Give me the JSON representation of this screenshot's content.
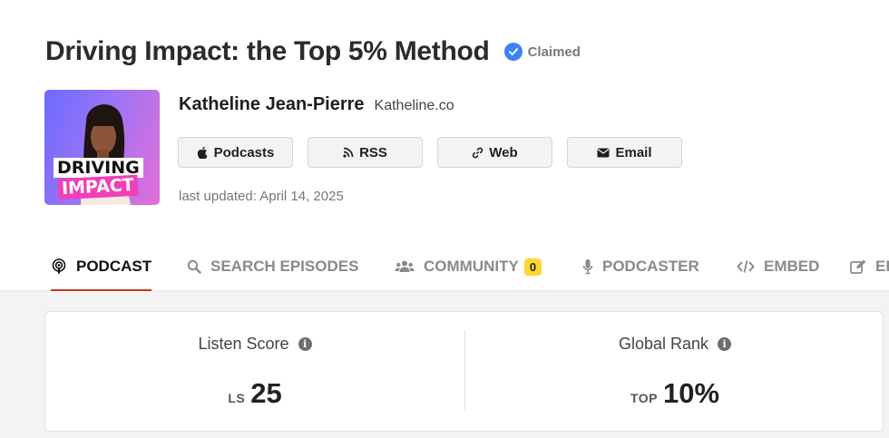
{
  "podcast": {
    "title": "Driving Impact: the Top 5% Method",
    "claimed_label": "Claimed",
    "cover": {
      "word1": "DRIVING",
      "word2": "IMPACT"
    },
    "author": "Katheline Jean-Pierre",
    "website": "Katheline.co",
    "last_updated": "last updated: April 14, 2025"
  },
  "links": [
    {
      "label": "Podcasts",
      "icon": "apple-icon"
    },
    {
      "label": "RSS",
      "icon": "rss-icon"
    },
    {
      "label": "Web",
      "icon": "link-icon"
    },
    {
      "label": "Email",
      "icon": "envelope-icon"
    }
  ],
  "tabs": [
    {
      "label": "PODCAST",
      "icon": "podcast-icon",
      "active": true
    },
    {
      "label": "SEARCH EPISODES",
      "icon": "search-icon"
    },
    {
      "label": "COMMUNITY",
      "icon": "users-icon",
      "badge": "0"
    },
    {
      "label": "PODCASTER",
      "icon": "microphone-icon"
    },
    {
      "label": "EMBED",
      "icon": "code-icon"
    },
    {
      "label": "ED",
      "icon": "edit-icon"
    }
  ],
  "scores": {
    "listen": {
      "label": "Listen Score",
      "prefix": "LS",
      "value": "25"
    },
    "rank": {
      "label": "Global Rank",
      "prefix": "TOP",
      "value": "10%"
    }
  },
  "colors": {
    "accent": "#c0391b",
    "badge": "#ffd633",
    "verified": "#3b82f6"
  }
}
